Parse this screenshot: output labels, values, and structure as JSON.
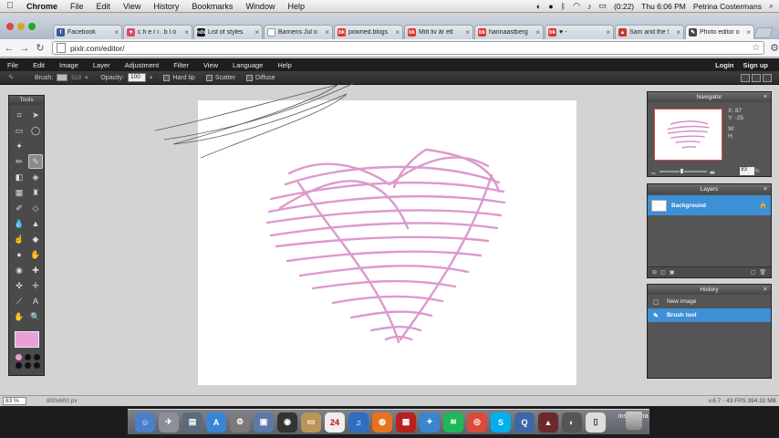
{
  "menubar": {
    "app": "Chrome",
    "items": [
      "File",
      "Edit",
      "View",
      "History",
      "Bookmarks",
      "Window",
      "Help"
    ],
    "battery": "(0:22)",
    "clock": "Thu 6:06 PM",
    "user": "Petrina Costermans"
  },
  "tabs": [
    {
      "title": "Facebook",
      "fav": "f",
      "color": "#3b5998"
    },
    {
      "title": "c h e r i . b l o",
      "fav": "♥",
      "color": "#d84b6b"
    },
    {
      "title": "List of styles",
      "fav": "nds",
      "color": "#111111"
    },
    {
      "title": "Barnens Jul o",
      "fav": "",
      "color": "#ffffff"
    },
    {
      "title": "powned.blogs",
      "fav": "bk",
      "color": "#e0332b"
    },
    {
      "title": "Mitt liv är ett",
      "fav": "bk",
      "color": "#e0332b"
    },
    {
      "title": "hannaastberg",
      "fav": "bk",
      "color": "#e0332b"
    },
    {
      "title": "♥ -",
      "fav": "bk",
      "color": "#e0332b"
    },
    {
      "title": "Sam and the !",
      "fav": "▲",
      "color": "#c33a2a"
    },
    {
      "title": "Photo editor o",
      "fav": "✎",
      "color": "#444444"
    }
  ],
  "address": {
    "url": "pixlr.com/editor/"
  },
  "pixlr_menu": {
    "items": [
      "File",
      "Edit",
      "Image",
      "Layer",
      "Adjustment",
      "Filter",
      "View",
      "Language",
      "Help"
    ],
    "login": "Login",
    "signup": "Sign up"
  },
  "options": {
    "brush_label": "Brush:",
    "brush_size": "510",
    "opacity_label": "Opacity:",
    "opacity_value": "100",
    "hard_tip": "Hard tip",
    "scatter": "Scatter",
    "diffuse": "Diffuse"
  },
  "tools_panel": {
    "title": "Tools",
    "foreground_color": "#e9a0d6"
  },
  "navigator": {
    "title": "Navigator",
    "x": "X: 87",
    "y": "Y: -25",
    "w": "W:",
    "h": "H:",
    "zoom": "83",
    "pct": "%"
  },
  "layers": {
    "title": "Layers",
    "items": [
      "Background"
    ]
  },
  "history": {
    "title": "History",
    "items": [
      "New image",
      "Brush tool"
    ]
  },
  "status": {
    "zoom": "83 %",
    "dims": "800x600 px",
    "fps": "v.6.7 - 43 FPS 394.32 MB"
  },
  "dock": {
    "label": "inspo göra"
  },
  "colors": {
    "brush_stroke": "#d888c6",
    "accent_blue": "#3d8fd6"
  }
}
